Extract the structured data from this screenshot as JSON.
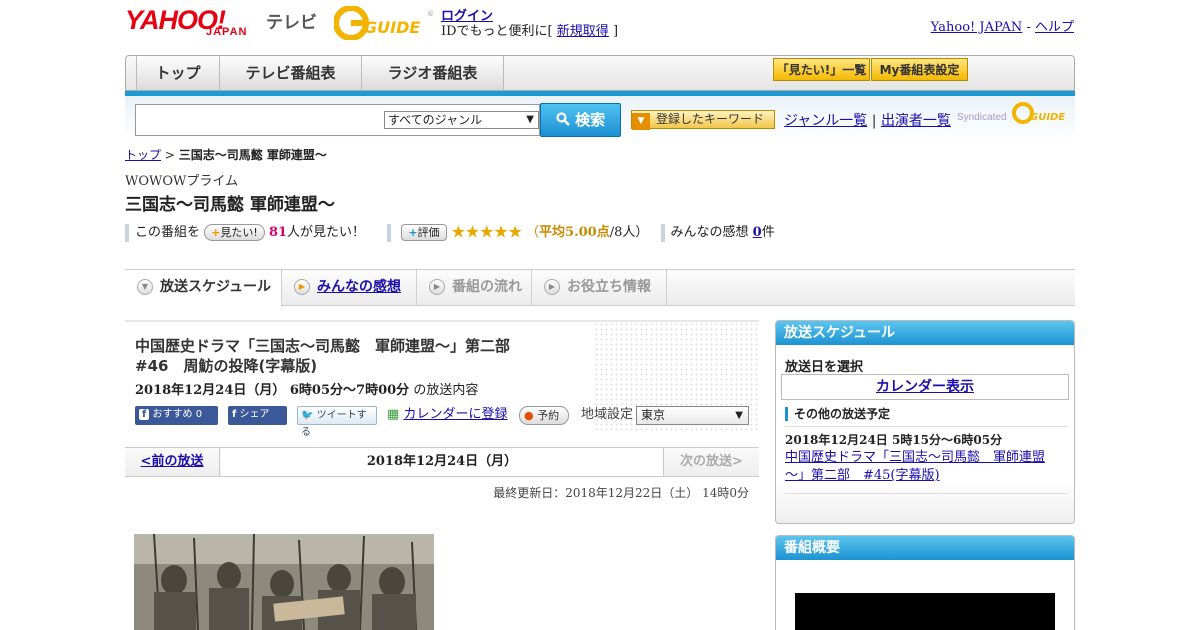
{
  "header": {
    "logo_yahoo": "YAHOO!",
    "logo_japan": "JAPAN",
    "logo_service": "テレビ",
    "guide_logo": "G-GUIDE",
    "login": "ログイン",
    "login_sub_prefix": "IDでもっと便利に[",
    "signup": "新規取得",
    "login_sub_suffix": "]",
    "yahoo_japan": "Yahoo! JAPAN",
    "separator": "-",
    "help": "ヘルプ"
  },
  "nav": {
    "tabs": [
      "トップ",
      "テレビ番組表",
      "ラジオ番組表"
    ],
    "want_list": "「見たい!」一覧",
    "my_schedule": "My番組表設定"
  },
  "search": {
    "genre": "すべてのジャンル",
    "button": "検索",
    "keyword_button": "登録したキーワード",
    "genre_list": "ジャンル一覧",
    "separator": "|",
    "performer_list": "出演者一覧",
    "syndicated": "Syndicated"
  },
  "breadcrumb": {
    "top": "トップ",
    "sep": ">",
    "current": "三国志～司馬懿 軍師連盟～"
  },
  "program": {
    "channel": "WOWOWプライム",
    "title": "三国志～司馬懿 軍師連盟～",
    "want_prefix": "この番組を",
    "want_button": "見たい!",
    "want_count": "81",
    "want_suffix": "人が見たい！",
    "rate_button": "評価",
    "stars": "★★★★★",
    "rating_avg_prefix": "（",
    "rating_avg": "平均5.00点",
    "rating_count": "/8人）",
    "impressions_label": "みんなの感想",
    "impressions_count": "0",
    "impressions_unit": "件"
  },
  "subtabs": [
    "放送スケジュール",
    "みんなの感想",
    "番組の流れ",
    "お役立ち情報"
  ],
  "episode": {
    "title_line1": "中国歴史ドラマ「三国志～司馬懿　軍師連盟～」第二部",
    "title_line2": "#46　周魴の投降(字幕版)",
    "datetime": "2018年12月24日（月） 6時05分～7時00分",
    "datetime_suffix": "の放送内容"
  },
  "social": {
    "fb_recommend": "おすすめ 0",
    "fb_share": "シェア",
    "tweet": "ツイートする",
    "calendar": "カレンダーに登録",
    "reserve": "予約",
    "region_label": "地域設定",
    "region": "東京"
  },
  "pager": {
    "prev": "<前の放送",
    "date": "2018年12月24日（月）",
    "next": "次の放送>"
  },
  "updated": "最終更新日：2018年12月22日（土） 14時0分",
  "schedule_panel": {
    "title": "放送スケジュール",
    "select_date": "放送日を選択",
    "calendar": "カレンダー表示",
    "other_label": "その他の放送予定",
    "other_time": "2018年12月24日 5時15分～6時05分",
    "other_link": "中国歴史ドラマ「三国志～司馬懿　軍師連盟～」第二部　#45(字幕版)"
  },
  "overview_panel": {
    "title": "番組概要"
  },
  "colors": {
    "accent_blue": "#1c93d2",
    "yahoo_red": "#e60012",
    "star_gold": "#e8a800",
    "want_count_pink": "#d6006f"
  }
}
